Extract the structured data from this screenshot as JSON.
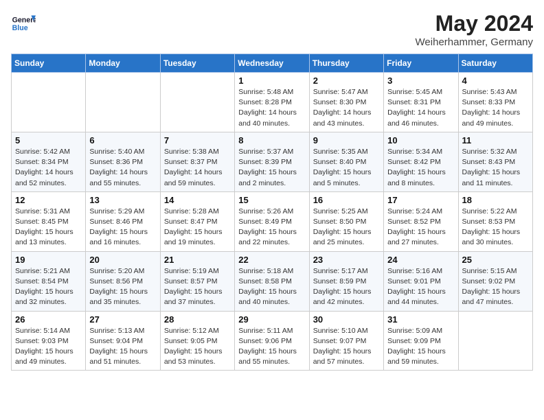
{
  "logo": {
    "line1": "General",
    "line2": "Blue"
  },
  "title": "May 2024",
  "location": "Weiherhammer, Germany",
  "header_days": [
    "Sunday",
    "Monday",
    "Tuesday",
    "Wednesday",
    "Thursday",
    "Friday",
    "Saturday"
  ],
  "weeks": [
    [
      {
        "day": "",
        "info": ""
      },
      {
        "day": "",
        "info": ""
      },
      {
        "day": "",
        "info": ""
      },
      {
        "day": "1",
        "info": "Sunrise: 5:48 AM\nSunset: 8:28 PM\nDaylight: 14 hours\nand 40 minutes."
      },
      {
        "day": "2",
        "info": "Sunrise: 5:47 AM\nSunset: 8:30 PM\nDaylight: 14 hours\nand 43 minutes."
      },
      {
        "day": "3",
        "info": "Sunrise: 5:45 AM\nSunset: 8:31 PM\nDaylight: 14 hours\nand 46 minutes."
      },
      {
        "day": "4",
        "info": "Sunrise: 5:43 AM\nSunset: 8:33 PM\nDaylight: 14 hours\nand 49 minutes."
      }
    ],
    [
      {
        "day": "5",
        "info": "Sunrise: 5:42 AM\nSunset: 8:34 PM\nDaylight: 14 hours\nand 52 minutes."
      },
      {
        "day": "6",
        "info": "Sunrise: 5:40 AM\nSunset: 8:36 PM\nDaylight: 14 hours\nand 55 minutes."
      },
      {
        "day": "7",
        "info": "Sunrise: 5:38 AM\nSunset: 8:37 PM\nDaylight: 14 hours\nand 59 minutes."
      },
      {
        "day": "8",
        "info": "Sunrise: 5:37 AM\nSunset: 8:39 PM\nDaylight: 15 hours\nand 2 minutes."
      },
      {
        "day": "9",
        "info": "Sunrise: 5:35 AM\nSunset: 8:40 PM\nDaylight: 15 hours\nand 5 minutes."
      },
      {
        "day": "10",
        "info": "Sunrise: 5:34 AM\nSunset: 8:42 PM\nDaylight: 15 hours\nand 8 minutes."
      },
      {
        "day": "11",
        "info": "Sunrise: 5:32 AM\nSunset: 8:43 PM\nDaylight: 15 hours\nand 11 minutes."
      }
    ],
    [
      {
        "day": "12",
        "info": "Sunrise: 5:31 AM\nSunset: 8:45 PM\nDaylight: 15 hours\nand 13 minutes."
      },
      {
        "day": "13",
        "info": "Sunrise: 5:29 AM\nSunset: 8:46 PM\nDaylight: 15 hours\nand 16 minutes."
      },
      {
        "day": "14",
        "info": "Sunrise: 5:28 AM\nSunset: 8:47 PM\nDaylight: 15 hours\nand 19 minutes."
      },
      {
        "day": "15",
        "info": "Sunrise: 5:26 AM\nSunset: 8:49 PM\nDaylight: 15 hours\nand 22 minutes."
      },
      {
        "day": "16",
        "info": "Sunrise: 5:25 AM\nSunset: 8:50 PM\nDaylight: 15 hours\nand 25 minutes."
      },
      {
        "day": "17",
        "info": "Sunrise: 5:24 AM\nSunset: 8:52 PM\nDaylight: 15 hours\nand 27 minutes."
      },
      {
        "day": "18",
        "info": "Sunrise: 5:22 AM\nSunset: 8:53 PM\nDaylight: 15 hours\nand 30 minutes."
      }
    ],
    [
      {
        "day": "19",
        "info": "Sunrise: 5:21 AM\nSunset: 8:54 PM\nDaylight: 15 hours\nand 32 minutes."
      },
      {
        "day": "20",
        "info": "Sunrise: 5:20 AM\nSunset: 8:56 PM\nDaylight: 15 hours\nand 35 minutes."
      },
      {
        "day": "21",
        "info": "Sunrise: 5:19 AM\nSunset: 8:57 PM\nDaylight: 15 hours\nand 37 minutes."
      },
      {
        "day": "22",
        "info": "Sunrise: 5:18 AM\nSunset: 8:58 PM\nDaylight: 15 hours\nand 40 minutes."
      },
      {
        "day": "23",
        "info": "Sunrise: 5:17 AM\nSunset: 8:59 PM\nDaylight: 15 hours\nand 42 minutes."
      },
      {
        "day": "24",
        "info": "Sunrise: 5:16 AM\nSunset: 9:01 PM\nDaylight: 15 hours\nand 44 minutes."
      },
      {
        "day": "25",
        "info": "Sunrise: 5:15 AM\nSunset: 9:02 PM\nDaylight: 15 hours\nand 47 minutes."
      }
    ],
    [
      {
        "day": "26",
        "info": "Sunrise: 5:14 AM\nSunset: 9:03 PM\nDaylight: 15 hours\nand 49 minutes."
      },
      {
        "day": "27",
        "info": "Sunrise: 5:13 AM\nSunset: 9:04 PM\nDaylight: 15 hours\nand 51 minutes."
      },
      {
        "day": "28",
        "info": "Sunrise: 5:12 AM\nSunset: 9:05 PM\nDaylight: 15 hours\nand 53 minutes."
      },
      {
        "day": "29",
        "info": "Sunrise: 5:11 AM\nSunset: 9:06 PM\nDaylight: 15 hours\nand 55 minutes."
      },
      {
        "day": "30",
        "info": "Sunrise: 5:10 AM\nSunset: 9:07 PM\nDaylight: 15 hours\nand 57 minutes."
      },
      {
        "day": "31",
        "info": "Sunrise: 5:09 AM\nSunset: 9:09 PM\nDaylight: 15 hours\nand 59 minutes."
      },
      {
        "day": "",
        "info": ""
      }
    ]
  ]
}
